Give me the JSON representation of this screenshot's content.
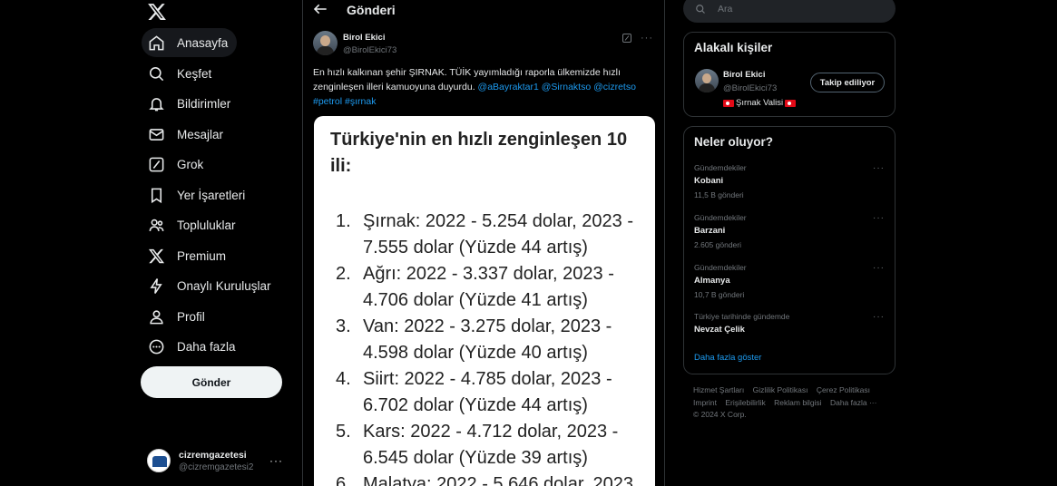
{
  "nav": {
    "items": [
      {
        "label": "Anasayfa",
        "icon": "home-icon"
      },
      {
        "label": "Keşfet",
        "icon": "search-icon"
      },
      {
        "label": "Bildirimler",
        "icon": "bell-icon"
      },
      {
        "label": "Mesajlar",
        "icon": "envelope-icon"
      },
      {
        "label": "Grok",
        "icon": "grok-icon"
      },
      {
        "label": "Yer İşaretleri",
        "icon": "bookmark-icon"
      },
      {
        "label": "Topluluklar",
        "icon": "people-icon"
      },
      {
        "label": "Premium",
        "icon": "x-logo-icon"
      },
      {
        "label": "Onaylı Kuruluşlar",
        "icon": "lightning-icon"
      },
      {
        "label": "Profil",
        "icon": "person-icon"
      },
      {
        "label": "Daha fazla",
        "icon": "more-circle-icon"
      }
    ],
    "post_button": "Gönder",
    "account": {
      "name": "cizremgazetesi",
      "handle": "@cizremgazetesi2"
    }
  },
  "main": {
    "title": "Gönderi",
    "post": {
      "author_name": "Birol Ekici",
      "author_handle": "@BirolEkici73",
      "text_plain": "En hızlı kalkınan şehir ŞIRNAK. TÜİK yayımladığı raporla ülkemizde hızlı zenginleşen illeri kamuoyuna duyurdu.",
      "mentions": [
        "@aBayraktar1",
        "@Sirnaktso",
        "@cizretso"
      ],
      "hashtags": [
        "#petrol",
        "#şırnak"
      ],
      "image": {
        "title": "Türkiye'nin en hızlı zenginleşen 10 ili:",
        "items": [
          {
            "num": "1.",
            "text": "Şırnak: 2022 - 5.254 dolar, 2023 - 7.555 dolar (Yüzde 44 artış)"
          },
          {
            "num": "2.",
            "text": "Ağrı: 2022 - 3.337 dolar, 2023 - 4.706 dolar (Yüzde 41 artış)"
          },
          {
            "num": "3.",
            "text": "Van: 2022 - 3.275 dolar, 2023 - 4.598 dolar (Yüzde 40 artış)"
          },
          {
            "num": "4.",
            "text": "Siirt: 2022 - 4.785 dolar, 2023 - 6.702 dolar (Yüzde 44 artış)"
          },
          {
            "num": "5.",
            "text": "Kars: 2022 - 4.712 dolar, 2023 - 6.545 dolar (Yüzde 39 artış)"
          },
          {
            "num": "6.",
            "text": "Malatya: 2022 - 5.646 dolar, 2023"
          }
        ]
      }
    }
  },
  "right": {
    "search_placeholder": "Ara",
    "related": {
      "title": "Alakalı kişiler",
      "name": "Birol Ekici",
      "handle": "@BirolEkici73",
      "bio": "Şırnak Valisi",
      "follow_label": "Takip ediliyor"
    },
    "trends": {
      "title": "Neler oluyor?",
      "items": [
        {
          "context": "Gündemdekiler",
          "name": "Kobani",
          "count": "11,5 B gönderi"
        },
        {
          "context": "Gündemdekiler",
          "name": "Barzani",
          "count": "2.605 gönderi"
        },
        {
          "context": "Gündemdekiler",
          "name": "Almanya",
          "count": "10,7 B gönderi"
        },
        {
          "context": "Türkiye tarihinde gündemde",
          "name": "Nevzat Çelik",
          "count": ""
        }
      ],
      "show_more": "Daha fazla göster"
    },
    "footer": [
      "Hizmet Şartları",
      "Gizlilik Politikası",
      "Çerez Politikası",
      "Imprint",
      "Erişilebilirlik",
      "Reklam bilgisi",
      "Daha fazla ···",
      "© 2024 X Corp."
    ]
  }
}
